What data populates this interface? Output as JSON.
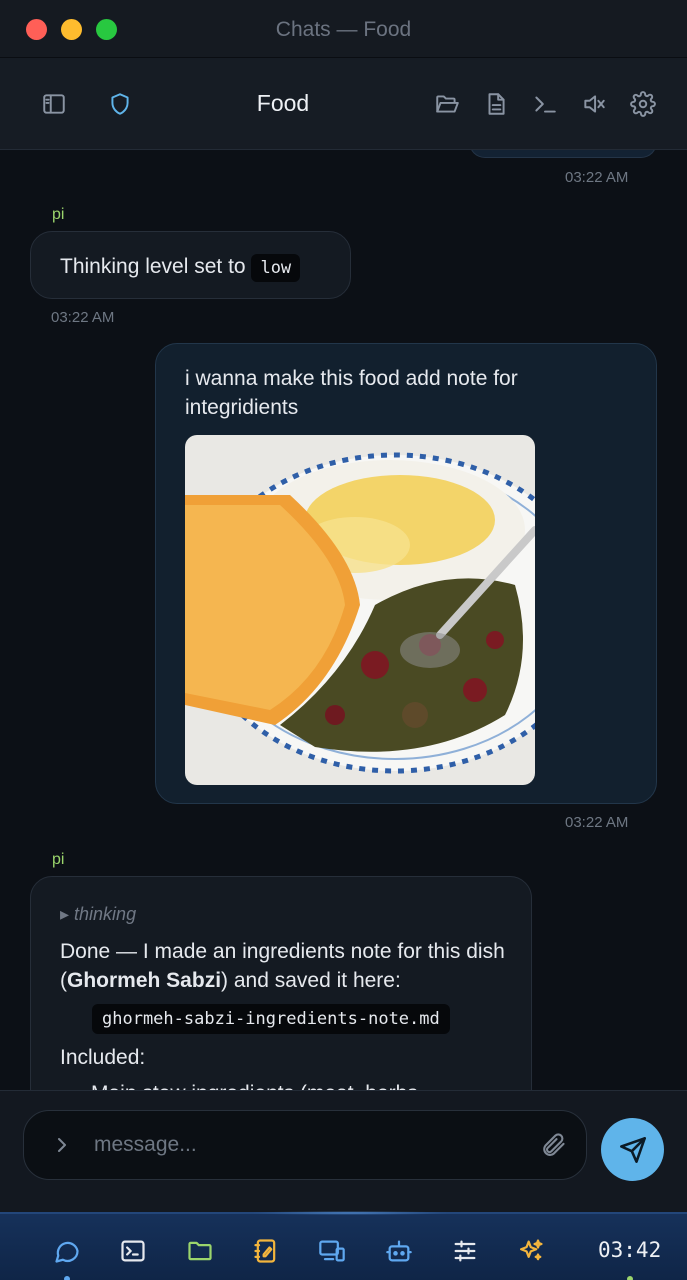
{
  "window": {
    "title": "Chats — Food"
  },
  "header": {
    "title": "Food"
  },
  "colors": {
    "accent": "#5fb4ea",
    "sender": "#9bd56c",
    "background": "#0c1016"
  },
  "icons": {
    "header_left": [
      "sidebar-icon",
      "shield-icon"
    ],
    "header_right": [
      "folder-open-icon",
      "document-icon",
      "terminal-icon",
      "speaker-muted-icon",
      "settings-gear-icon"
    ]
  },
  "messages": [
    {
      "kind": "user-partial",
      "time": "03:22 AM"
    },
    {
      "kind": "assistant",
      "sender": "pi",
      "text": "Thinking level set to",
      "code": "low",
      "time": "03:22 AM"
    },
    {
      "kind": "user",
      "text": "i wanna make this food add note for integridients",
      "image_alt": "Ghormeh Sabzi with saffron rice and tahdig",
      "time": "03:22 AM"
    },
    {
      "kind": "assistant",
      "sender": "pi",
      "thinking_label": "▸ thinking",
      "text_before": "Done — I made an ingredients note for this dish (",
      "bold": "Ghormeh Sabzi",
      "text_after": ") and saved it here:",
      "file": "ghormeh-sabzi-ingredients-note.md",
      "included_label": "Included:",
      "partial_line": "Main stew ingredients (meat, herbs,"
    }
  ],
  "composer": {
    "placeholder": "message..."
  },
  "dock": {
    "items": [
      "chat-icon",
      "terminal-icon",
      "folder-icon",
      "notebook-icon",
      "devices-icon",
      "robot-icon",
      "sliders-icon",
      "sparkles-icon"
    ],
    "clock": "03:42"
  }
}
